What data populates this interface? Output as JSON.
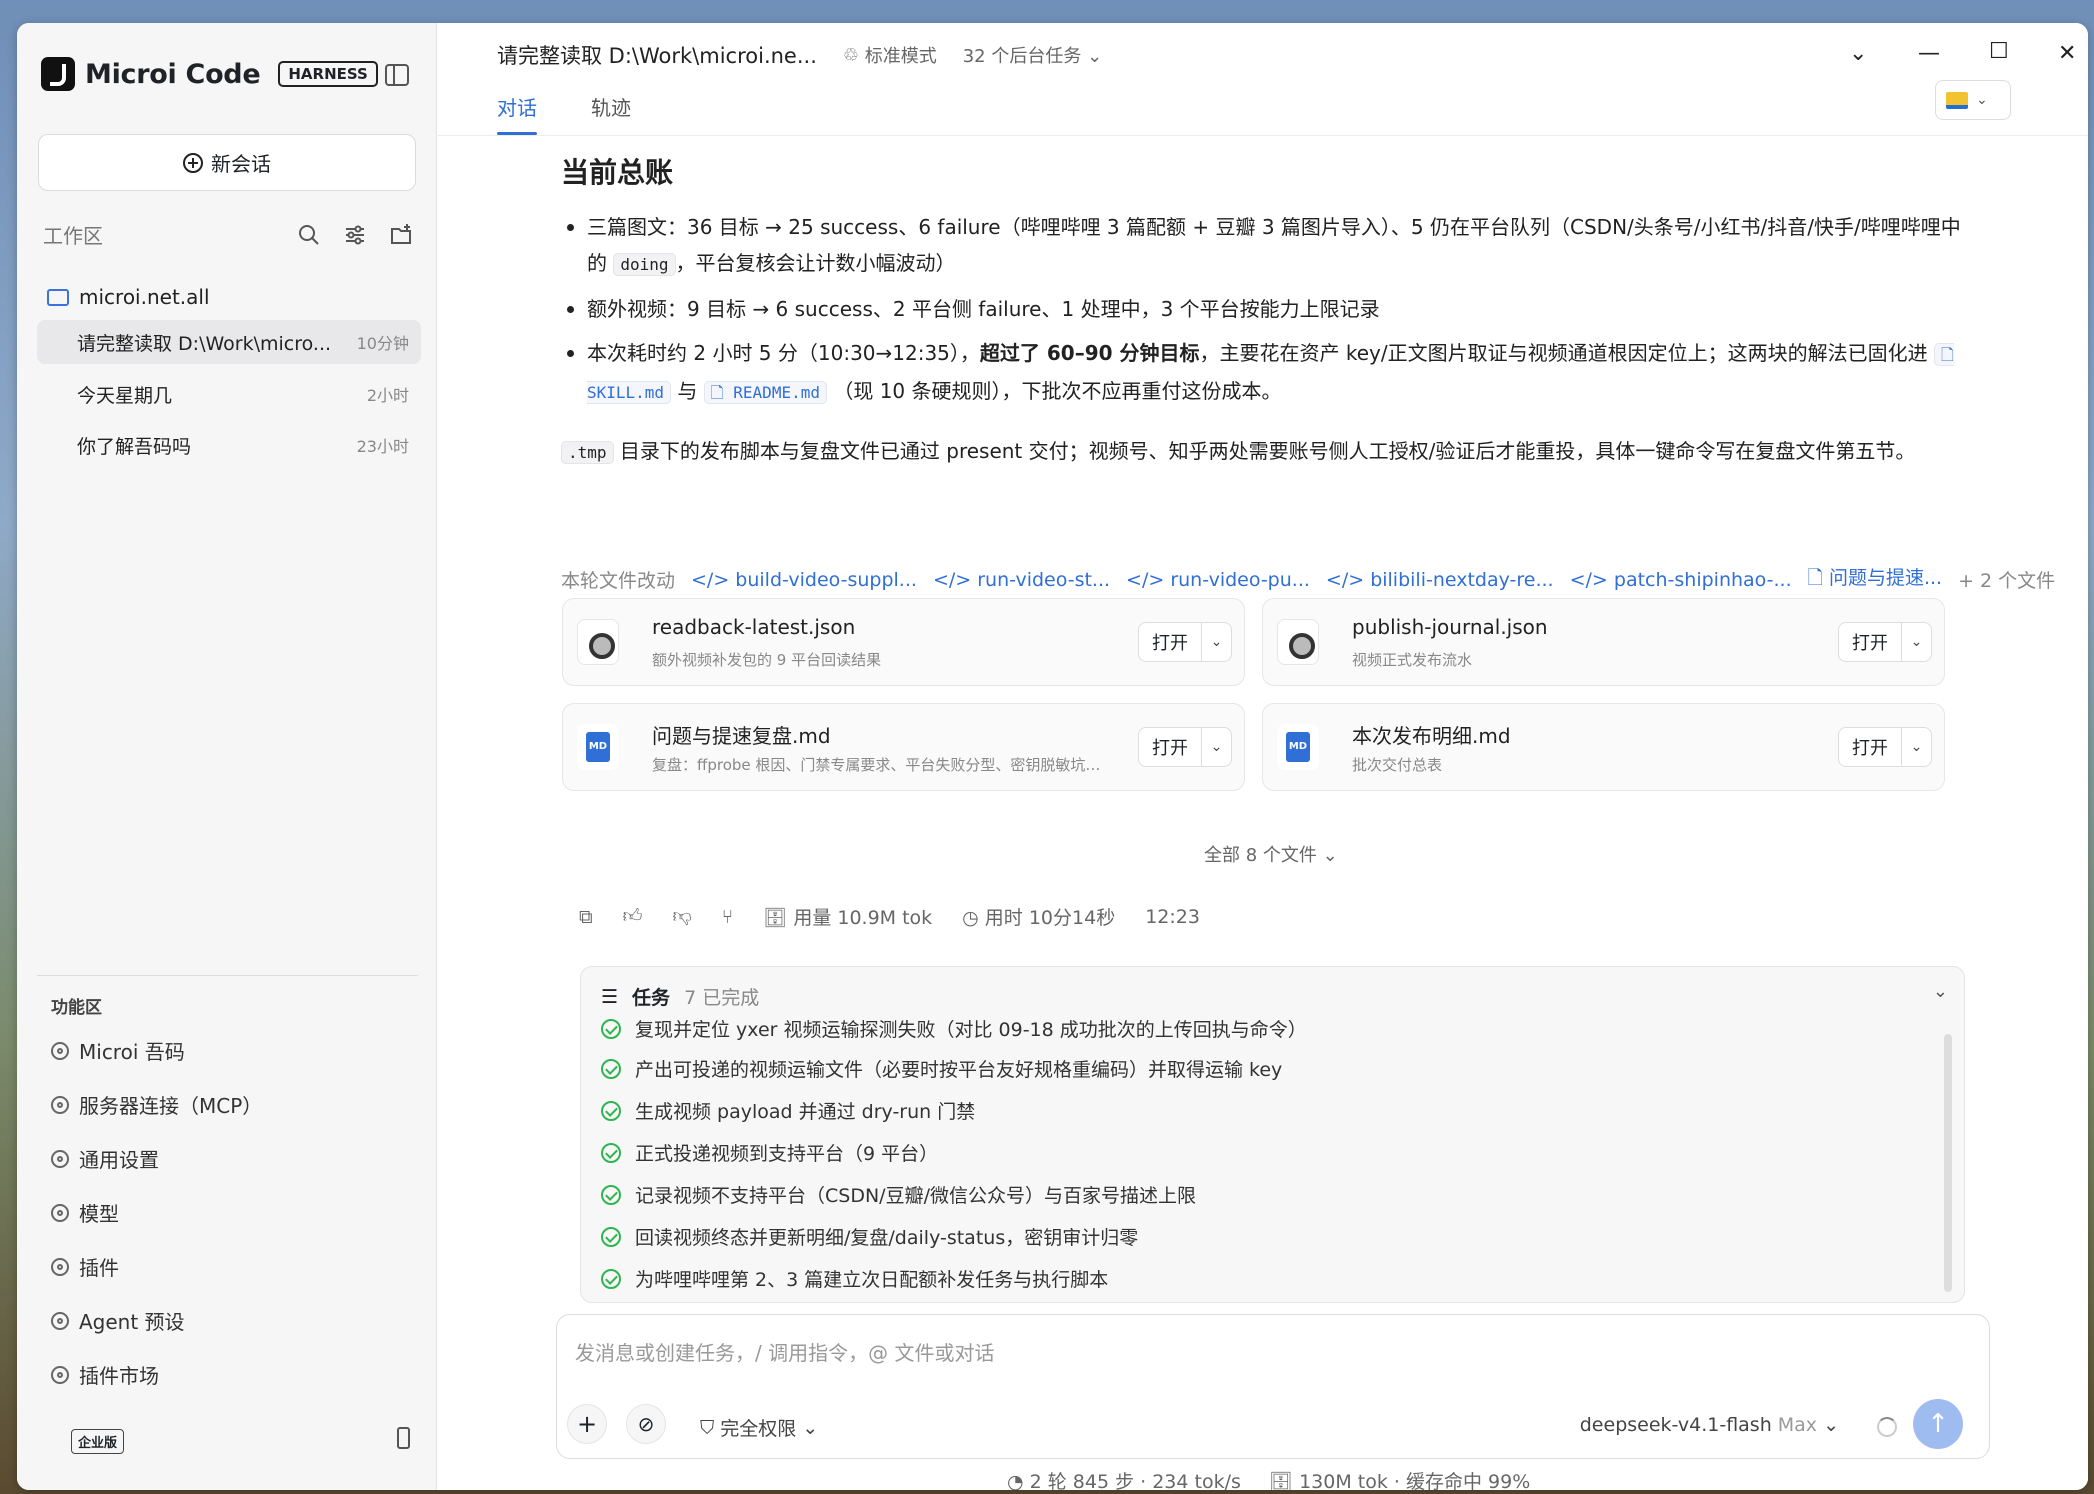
{
  "app": {
    "name": "Microi Code",
    "badge": "HARNESS"
  },
  "sidebar": {
    "new_chat": "新会话",
    "workspace_label": "工作区",
    "project": "microi.net.all",
    "conversations": [
      {
        "title": "请完整读取 D:\\Work\\micro...",
        "time": "10分钟"
      },
      {
        "title": "今天星期几",
        "time": "2小时"
      },
      {
        "title": "你了解吾码吗",
        "time": "23小时"
      }
    ],
    "features_label": "功能区",
    "features": [
      "Microi 吾码",
      "服务器连接（MCP）",
      "通用设置",
      "模型",
      "插件",
      "Agent 预设",
      "插件市场"
    ],
    "edition": "企业版"
  },
  "header": {
    "title": "请完整读取 D:\\Work\\microi.ne...",
    "mode": "标准模式",
    "bg_tasks": "32 个后台任务",
    "tabs": [
      "对话",
      "轨迹"
    ]
  },
  "content": {
    "heading": "当前总账",
    "b1": "三篇图文：36 目标 → 25 success、6 failure（哔哩哔哩 3 篇配额 + 豆瓣 3 篇图片导入）、5 仍在平台队列（CSDN/头条号/小红书/抖音/快手/哔哩哔哩中的",
    "b1_code": "doing",
    "b1_tail": "，平台复核会让计数小幅波动）",
    "b2": "额外视频：9 目标 → 6 success、2 平台侧 failure、1 处理中，3 个平台按能力上限记录",
    "b3_pre": "本次耗时约 2 小时 5 分（10:30→12:35），",
    "b3_bold": "超过了 60–90 分钟目标",
    "b3_mid": "，主要花在资产 key/正文图片取证与视频通道根因定位上；这两块的解法已固化进",
    "b3_link1": "SKILL.md",
    "b3_and": "与",
    "b3_link2": "README.md",
    "b3_tail": "（现 10 条硬规则），下批次不应再重付这份成本。",
    "p_code": ".tmp",
    "p_text": "目录下的发布脚本与复盘文件已通过 present 交付；视频号、知乎两处需要账号侧人工授权/验证后才能重投，具体一键命令写在复盘文件第五节。"
  },
  "changes": {
    "label": "本轮文件改动",
    "files": [
      "build-video-suppl...",
      "run-video-st...",
      "run-video-pu...",
      "bilibili-nextday-re...",
      "patch-shipinhao-...",
      "问题与提速..."
    ],
    "more": "+ 2 个文件"
  },
  "files": [
    {
      "name": "readback-latest.json",
      "desc": "额外视频补发包的 9 平台回读结果",
      "type": "json"
    },
    {
      "name": "publish-journal.json",
      "desc": "视频正式发布流水",
      "type": "json"
    },
    {
      "name": "问题与提速复盘.md",
      "desc": "复盘：ffprobe 根因、门禁专属要求、平台失败分型、密钥脱敏坑、...",
      "type": "md"
    },
    {
      "name": "本次发布明细.md",
      "desc": "批次交付总表",
      "type": "md"
    }
  ],
  "open_label": "打开",
  "all_files": "全部 8 个文件",
  "stats": {
    "usage": "用量 10.9M tok",
    "elapsed": "用时 10分14秒",
    "time": "12:23"
  },
  "tasks": {
    "title": "任务",
    "done": "7 已完成",
    "items": [
      "复现并定位 yxer 视频运输探测失败（对比 09-18 成功批次的上传回执与命令）",
      "产出可投递的视频运输文件（必要时按平台友好规格重编码）并取得运输 key",
      "生成视频 payload 并通过 dry-run 门禁",
      "正式投递视频到支持平台（9 平台）",
      "记录视频不支持平台（CSDN/豆瓣/微信公众号）与百家号描述上限",
      "回读视频终态并更新明细/复盘/daily-status，密钥审计归零",
      "为哔哩哔哩第 2、3 篇建立次日配额补发任务与执行脚本"
    ]
  },
  "composer": {
    "placeholder": "发消息或创建任务，/ 调用指令，@ 文件或对话",
    "permission": "完全权限",
    "model": "deepseek-v4.1-flash",
    "model_mode": "Max"
  },
  "status_bar": {
    "left": "2 轮 845 步 · 234 tok/s",
    "right": "130M tok · 缓存命中 99%"
  }
}
